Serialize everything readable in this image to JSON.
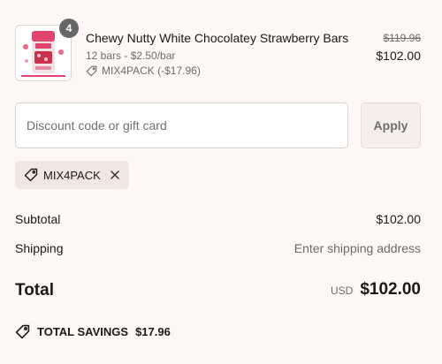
{
  "product": {
    "quantity_badge": "4",
    "name": "Chewy Nutty White Chocolatey Strawberry Bars",
    "variant": "12 bars - $2.50/bar",
    "discount_line": "MIX4PACK (-$17.96)",
    "price_original": "$119.96",
    "price_final": "$102.00",
    "thumbnail_icon": "product-package-image"
  },
  "discount": {
    "placeholder": "Discount code or gift card",
    "value": "",
    "apply_label": "Apply"
  },
  "applied_code": {
    "label": "MIX4PACK",
    "tag_icon": "tag-icon",
    "remove_icon": "close-icon"
  },
  "summary": {
    "subtotal_label": "Subtotal",
    "subtotal_value": "$102.00",
    "shipping_label": "Shipping",
    "shipping_value": "Enter shipping address",
    "total_label": "Total",
    "total_currency": "USD",
    "total_value": "$102.00"
  },
  "savings": {
    "label": "TOTAL SAVINGS",
    "amount": "$17.96",
    "icon": "savings-tag-icon"
  },
  "colors": {
    "background": "#fdf8f6",
    "tag_background": "#f1e6e1",
    "badge": "#666666",
    "muted_text": "#6b6b6b",
    "product_accent": "#e0456e"
  }
}
